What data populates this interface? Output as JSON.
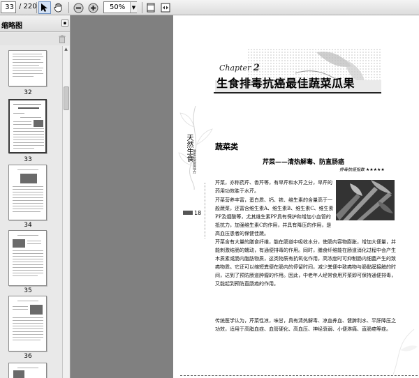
{
  "toolbar": {
    "page_current": "33",
    "page_total": "/ 220",
    "zoom_value": "50%",
    "icons": [
      "select-tool-icon",
      "hand-tool-icon",
      "zoom-out-icon",
      "zoom-in-icon",
      "fit-page-icon",
      "fit-width-icon"
    ]
  },
  "thumbnails": {
    "title": "缩略图",
    "items": [
      {
        "label": "32"
      },
      {
        "label": "33"
      },
      {
        "label": "34"
      },
      {
        "label": "35"
      },
      {
        "label": "36"
      }
    ]
  },
  "page": {
    "chapter_word": "Chapter",
    "chapter_number": "2",
    "chapter_title": "生食排毒抗癌最佳蔬菜瓜果",
    "side_title": "天然生食",
    "side_subtitle": "排毒抗癌最佳方",
    "page_number": "18",
    "section_heading": "蔬菜类",
    "article_title": "芹菜——清热解毒、防直肠癌",
    "rating": "排毒抗癌指数 ★★★★★",
    "paragraphs": {
      "p1": "芹菜，亦称药芹、香芹等，有旱芹和水芹之分，旱芹的药用功效胜于水芹。",
      "p1_cont": "芹菜营养丰富，蛋白质、钙、铁、维生素的含量高于一般蔬菜，还富含维生素A、维生素B、维生素C、维生素PP及烟酸等，尤其维生素PP具有保护和增加小血管的抵抗力，加强维生素C的作用，并具有降压的作用，是高血压患者的保健佳蔬。",
      "p2": "芹菜含有大量的膳食纤维，能在肠道中吸收水分，使肠内容物膨胀，增加大便量，并能刺激结肠的蠕动，有通便排毒的作用。同时，膳食纤维能在肠道消化过程中会产生木质素或肠内脂肪物质，这类物质有抗氧化作用，高浓度时可抑制肠内细菌产生的致癌物质。它还可以缩短粪便在肠内的停留时间，减少粪便中致癌物与肠黏膜接触的时间，达到了预防肠道肿瘤的作用。因此，中老年人经常食用芹菜即可保持通便排毒，又能起到预防直肠癌的作用。",
      "p3": "传统医学认为，芹菜性凉，味甘，具有清热解毒、凉血养血、健脾利水、平肝降压之功效，适用于高脂血症、血管硬化、高血压、神经衰弱、小便淋痛、直肠癌等症。"
    }
  },
  "colors": {
    "toolbar_bg": "#dcdcdc",
    "viewer_bg": "#808080",
    "panel_bg": "#e9e9e9",
    "accent": "#6b8fc2"
  }
}
